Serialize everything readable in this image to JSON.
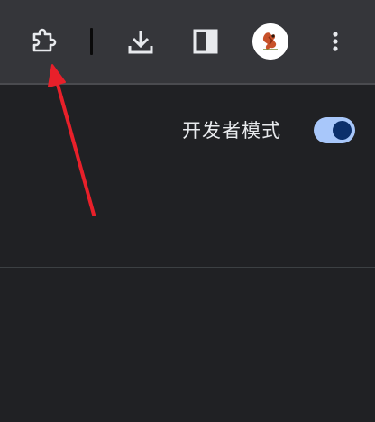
{
  "toolbar": {
    "icons": [
      "puzzle-icon",
      "download-icon",
      "side-panel-icon",
      "profile-avatar",
      "more-vert-icon"
    ]
  },
  "extensions_page": {
    "developer_mode_label": "开发者模式",
    "developer_mode_enabled": true
  },
  "colors": {
    "toolbar_bg": "#35363a",
    "page_bg": "#202124",
    "toggle_track": "#a8c7fa",
    "toggle_knob": "#0b2f6b",
    "annotation_arrow": "#e8202a"
  }
}
